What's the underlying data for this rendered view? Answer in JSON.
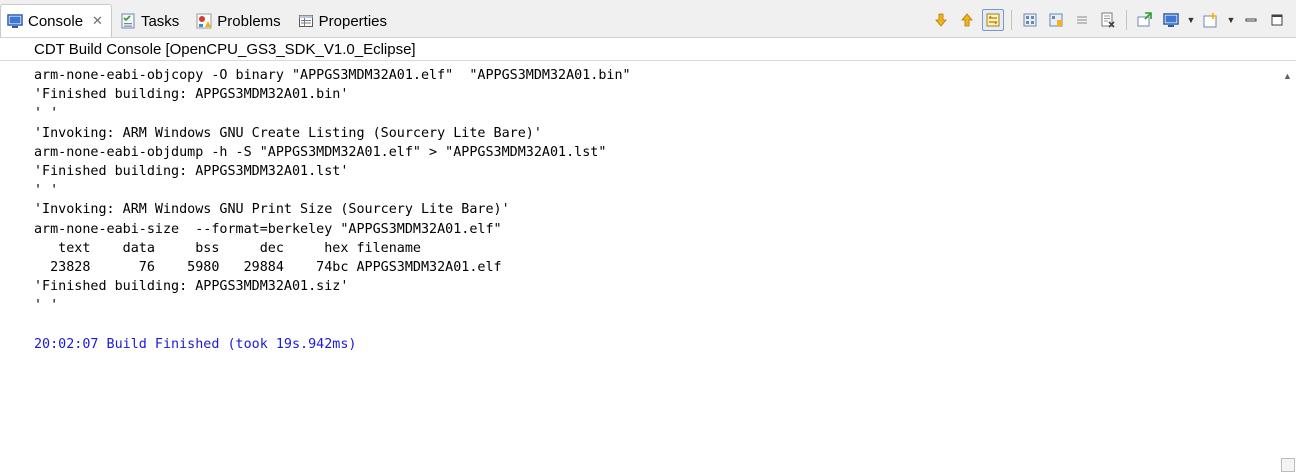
{
  "tabs": [
    {
      "label": "Console",
      "icon": "console-icon",
      "active": true,
      "close": "✕"
    },
    {
      "label": "Tasks",
      "icon": "tasks-icon"
    },
    {
      "label": "Problems",
      "icon": "problems-icon"
    },
    {
      "label": "Properties",
      "icon": "properties-icon"
    }
  ],
  "toolbar_icons": [
    "scroll-lock-down-icon",
    "scroll-lock-up-icon",
    "show-console-icon",
    "pin-console-icon",
    "word-wrap-icon",
    "clear-console-icon",
    "display-selected-console-icon",
    "open-console-icon",
    "minimize-icon",
    "maximize-icon"
  ],
  "console_title": "CDT Build Console [OpenCPU_GS3_SDK_V1.0_Eclipse]",
  "clipped_top_line": "            . .                                   .",
  "output_lines": [
    "arm-none-eabi-objcopy -O binary \"APPGS3MDM32A01.elf\"  \"APPGS3MDM32A01.bin\"",
    "'Finished building: APPGS3MDM32A01.bin'",
    "' '",
    "'Invoking: ARM Windows GNU Create Listing (Sourcery Lite Bare)'",
    "arm-none-eabi-objdump -h -S \"APPGS3MDM32A01.elf\" > \"APPGS3MDM32A01.lst\"",
    "'Finished building: APPGS3MDM32A01.lst'",
    "' '",
    "'Invoking: ARM Windows GNU Print Size (Sourcery Lite Bare)'",
    "arm-none-eabi-size  --format=berkeley \"APPGS3MDM32A01.elf\"",
    "   text    data     bss     dec     hex filename",
    "  23828      76    5980   29884    74bc APPGS3MDM32A01.elf",
    "'Finished building: APPGS3MDM32A01.siz'",
    "' '",
    "",
    "20:02:07 Build Finished (took 19s.942ms)"
  ],
  "colors": {
    "finish_line": "#1b1bd8",
    "tab_bar": "#f0f0f0"
  }
}
